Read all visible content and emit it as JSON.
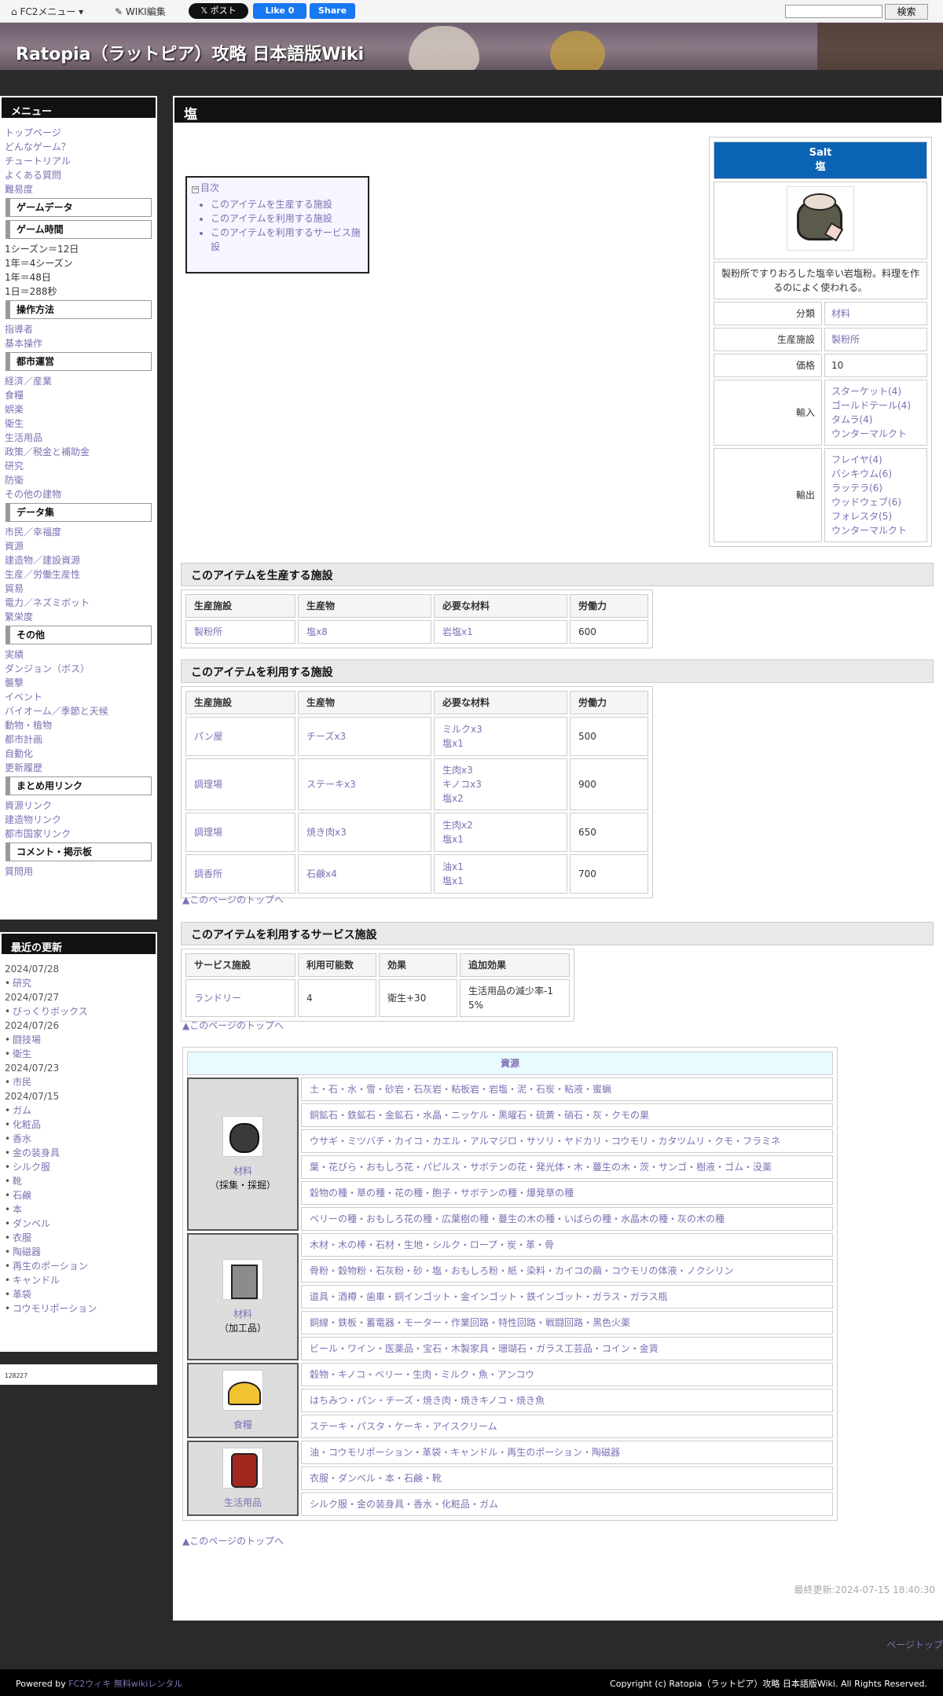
{
  "fc2bar": {
    "menu_label": "FC2メニュー",
    "wiki_edit": "WIKI編集",
    "x_post": "ポスト",
    "fb_like": "Like 0",
    "fb_share": "Share",
    "search_button": "検索"
  },
  "header": {
    "title": "Ratopia（ラットピア）攻略 日本語版Wiki"
  },
  "sidebar": {
    "menu_title": "メニュー",
    "links_top": [
      "トップページ",
      "どんなゲーム？",
      "チュートリアル",
      "よくある質問",
      "難易度"
    ],
    "sec_gamedata": "ゲームデータ",
    "sec_gametime": "ゲーム時間",
    "time_lines": [
      "1シーズン＝12日",
      "1年＝4シーズン",
      "1年＝48日",
      "1日＝288秒"
    ],
    "sec_operation": "操作方法",
    "links_operation": [
      "指導者",
      "基本操作"
    ],
    "sec_city": "都市運営",
    "links_city": [
      "経済／産業",
      "食糧",
      "娯楽",
      "衛生",
      "生活用品",
      "政策／税金と補助金",
      "研究",
      "防衛",
      "その他の建物"
    ],
    "sec_data": "データ集",
    "links_data": [
      "市民／幸福度",
      "資源",
      "建造物／建設資源",
      "生産／労働生産性",
      "貿易",
      "電力／ネズミボット",
      "繁栄度"
    ],
    "sec_other": "その他",
    "links_other": [
      "実績",
      "ダンジョン（ボス）",
      "襲撃",
      "イベント",
      "バイオーム／季節と天候",
      "動物・植物",
      "都市計画",
      "自動化",
      "更新履歴"
    ],
    "sec_summary": "まとめ用リンク",
    "links_summary": [
      "資源リンク",
      "建造物リンク",
      "都市国家リンク"
    ],
    "sec_comment": "コメント・掲示板",
    "links_comment": [
      "質問用"
    ],
    "recent_title": "最近の更新",
    "recent": [
      {
        "date": "2024/07/28",
        "items": [
          "研究"
        ]
      },
      {
        "date": "2024/07/27",
        "items": [
          "びっくりボックス"
        ]
      },
      {
        "date": "2024/07/26",
        "items": [
          "闘技場",
          "衛生"
        ]
      },
      {
        "date": "2024/07/23",
        "items": [
          "市民"
        ]
      },
      {
        "date": "2024/07/15",
        "items": [
          "ガム",
          "化粧品",
          "香水",
          "金の装身具",
          "シルク服",
          "靴",
          "石鹸",
          "本",
          "ダンベル",
          "衣服",
          "陶磁器",
          "再生のポーション",
          "キャンドル",
          "革袋",
          "コウモリポーション"
        ]
      }
    ],
    "counter": "128227"
  },
  "page": {
    "title": "塩",
    "toc_title": "目次",
    "toc": [
      "このアイテムを生産する施設",
      "このアイテムを利用する施設",
      "このアイテムを利用するサービス施設"
    ],
    "infobox": {
      "name_en": "Salt",
      "name_ja": "塩",
      "description": "製粉所ですりおろした塩辛い岩塩粉。料理を作るのによく使われる。",
      "category_label": "分類",
      "category": "材料",
      "facility_label": "生産施設",
      "facility": "製粉所",
      "price_label": "価格",
      "price": "10",
      "import_label": "輸入",
      "imports": [
        "スターケット(4)",
        "ゴールドテール(4)",
        "タムラ(4)",
        "ウンターマルクト"
      ],
      "export_label": "輸出",
      "exports": [
        "フレイヤ(4)",
        "バシキウム(6)",
        "ラッテラ(6)",
        "ウッドウェブ(6)",
        "フォレスタ(5)",
        "ウンターマルクト"
      ]
    },
    "section1": {
      "title": "このアイテムを生産する施設",
      "headers": [
        "生産施設",
        "生産物",
        "必要な材料",
        "労働力"
      ],
      "rows": [
        [
          "製粉所",
          "塩x8",
          "岩塩x1",
          "600"
        ]
      ]
    },
    "section2": {
      "title": "このアイテムを利用する施設",
      "headers": [
        "生産施設",
        "生産物",
        "必要な材料",
        "労働力"
      ],
      "rows": [
        [
          "パン屋",
          "チーズx3",
          "ミルクx3\n塩x1",
          "500"
        ],
        [
          "調理場",
          "ステーキx3",
          "生肉x3\nキノコx3\n塩x2",
          "900"
        ],
        [
          "調理場",
          "焼き肉x3",
          "生肉x2\n塩x1",
          "650"
        ],
        [
          "調香所",
          "石鹸x4",
          "油x1\n塩x1",
          "700"
        ]
      ]
    },
    "section3": {
      "title": "このアイテムを利用するサービス施設",
      "headers": [
        "サービス施設",
        "利用可能数",
        "効果",
        "追加効果"
      ],
      "rows": [
        [
          "ランドリー",
          "4",
          "衛生+30",
          "生活用品の減少率-1\n5%"
        ]
      ]
    },
    "back_to_top": "▲このページのトップへ",
    "nav": {
      "title": "資源",
      "groups": [
        {
          "icon": "rock-icon",
          "label": "材料",
          "sub": "（採集・採掘）",
          "rows": [
            "土・石・水・雪・砂岩・石灰岩・粘板岩・岩塩・泥・石炭・粘液・蜜蝋",
            "銅鉱石・鉄鉱石・金鉱石・水晶・ニッケル・黒曜石・硫黄・硝石・灰・クモの巣",
            "ウサギ・ミツバチ・カイコ・カエル・アルマジロ・サソリ・ヤドカリ・コウモリ・カタツムリ・クモ・フラミネ",
            "葉・花びら・おもしろ花・パピルス・サボテンの花・発光体・木・蔓生の木・茨・サンゴ・樹液・ゴム・没薬",
            "穀物の種・草の種・花の種・胞子・サボテンの種・爆発草の種",
            "ベリーの種・おもしろ花の種・広葉樹の種・蔓生の木の種・いばらの種・水晶木の種・灰の木の種"
          ]
        },
        {
          "icon": "crate-icon",
          "label": "材料",
          "sub": "（加工品）",
          "rows": [
            "木材・木の棒・石材・生地・シルク・ロープ・炭・革・骨",
            "骨粉・穀物粉・石灰粉・砂・塩・おもしろ粉・紙・染料・カイコの繭・コウモリの体液・ノクシリン",
            "道具・酒樽・歯車・銅インゴット・金インゴット・鉄インゴット・ガラス・ガラス瓶",
            "銅線・鉄板・蓄電器・モーター・作業回路・特性回路・戦闘回路・黒色火薬",
            "ビール・ワイン・医薬品・宝石・木製家具・珊瑚石・ガラス工芸品・コイン・金貨"
          ]
        },
        {
          "icon": "cheese-icon",
          "label": "食糧",
          "sub": "",
          "rows": [
            "穀物・キノコ・ベリー・生肉・ミルク・魚・アンコウ",
            "はちみつ・パン・チーズ・焼き肉・焼きキノコ・焼き魚",
            "ステーキ・パスタ・ケーキ・アイスクリーム"
          ]
        },
        {
          "icon": "clothes-icon",
          "label": "生活用品",
          "sub": "",
          "rows": [
            "油・コウモリポーション・革袋・キャンドル・再生のポーション・陶磁器",
            "衣服・ダンベル・本・石鹸・靴",
            "シルク服・金の装身具・香水・化粧品・ガム"
          ]
        }
      ]
    },
    "last_updated": "最終更新:2024-07-15 18:40:30"
  },
  "footer": {
    "page_top": "ページトップ",
    "powered_prefix": "Powered by",
    "powered_link": "FC2ウィキ 無料wikiレンタル",
    "copyright": "Copyright (c) Ratopia（ラットピア）攻略 日本語版Wiki. All Rights Reserved."
  }
}
